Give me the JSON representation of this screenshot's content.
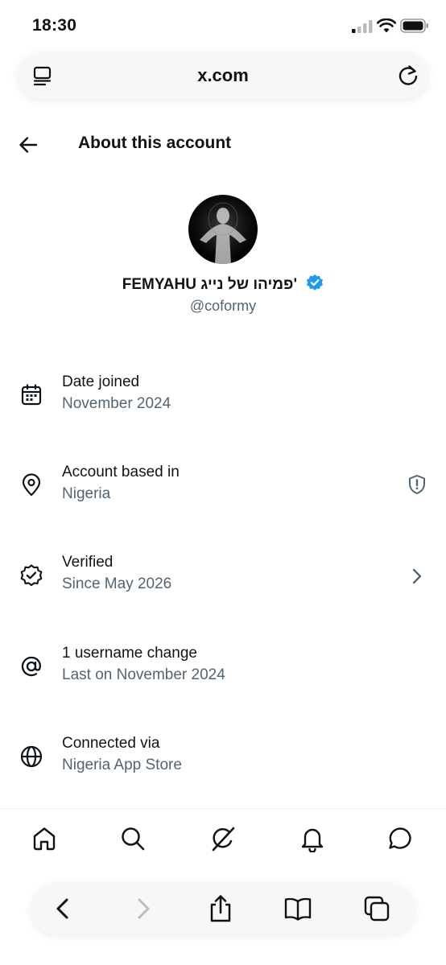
{
  "status_bar": {
    "time": "18:30"
  },
  "browser": {
    "url": "x.com"
  },
  "header": {
    "title": "About this account"
  },
  "profile": {
    "display_name": "FEMYAHU פמיהו של נייג'",
    "handle": "@coformy",
    "verified": true,
    "badge_color": "#1d9bf0"
  },
  "info_rows": [
    {
      "icon": "calendar-icon",
      "title": "Date joined",
      "subtitle": "November 2024"
    },
    {
      "icon": "location-pin-icon",
      "title": "Account based in",
      "subtitle": "Nigeria",
      "trailing_icon": "shield-alert-icon"
    },
    {
      "icon": "verified-seal-icon",
      "title": "Verified",
      "subtitle": "Since May 2026",
      "trailing_icon": "chevron-right-icon"
    },
    {
      "icon": "at-sign-icon",
      "title": "1 username change",
      "subtitle": "Last on November 2024"
    },
    {
      "icon": "globe-icon",
      "title": "Connected via",
      "subtitle": "Nigeria App Store"
    }
  ],
  "bottom_nav": [
    "home-icon",
    "search-icon",
    "grok-icon",
    "notifications-icon",
    "messages-icon"
  ],
  "safari_toolbar": [
    "back-icon",
    "forward-icon",
    "share-icon",
    "bookmarks-icon",
    "tabs-icon"
  ],
  "colors": {
    "text": "#0f1419",
    "secondary": "#536471",
    "accent": "#1d9bf0"
  }
}
